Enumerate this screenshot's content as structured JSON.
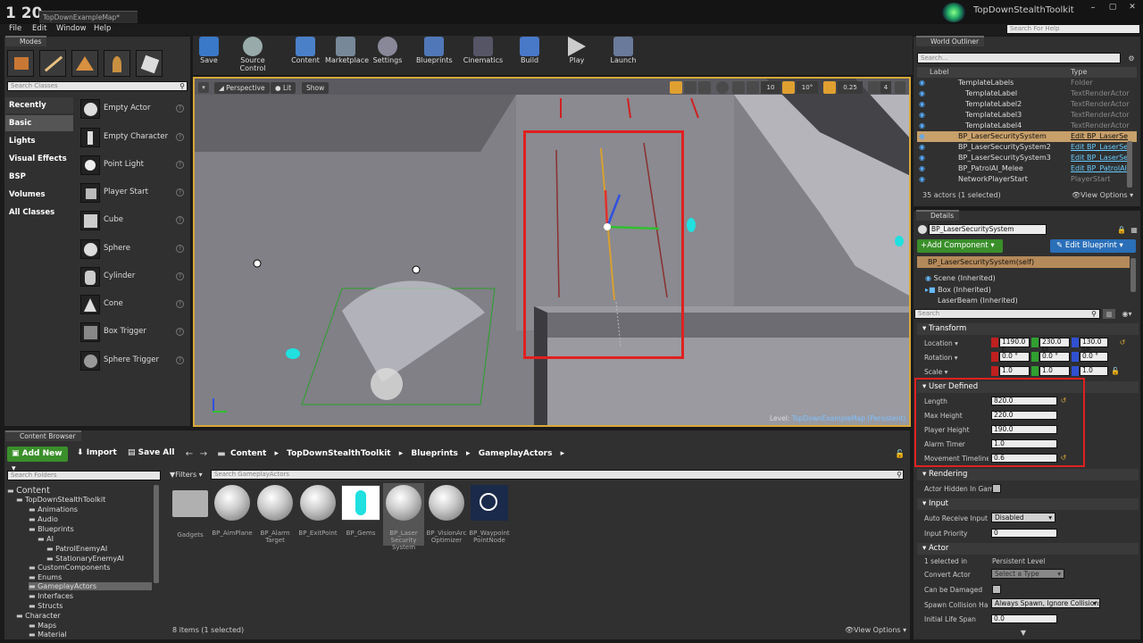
{
  "app": {
    "logo_text": "1 20",
    "tab_title": "TopDownExampleMap*",
    "project": "TopDownStealthToolkit",
    "help_search_placeholder": "Search For Help"
  },
  "menu": [
    "File",
    "Edit",
    "Window",
    "Help"
  ],
  "modes": {
    "tab": "Modes",
    "search_placeholder": "Search Classes",
    "categories": [
      "Recently Placed",
      "Basic",
      "Lights",
      "Visual Effects",
      "BSP",
      "Volumes",
      "All Classes"
    ],
    "items": [
      "Empty Actor",
      "Empty Character",
      "Point Light",
      "Player Start",
      "Cube",
      "Sphere",
      "Cylinder",
      "Cone",
      "Box Trigger",
      "Sphere Trigger"
    ]
  },
  "toolbar": [
    "Save",
    "Source Control",
    "Content",
    "Marketplace",
    "Settings",
    "Blueprints",
    "Cinematics",
    "Build",
    "Play",
    "Launch"
  ],
  "viewport": {
    "perspective": "Perspective",
    "lit": "Lit",
    "show": "Show",
    "grid": "10",
    "angle": "10°",
    "scale": "0.25",
    "cam": "4",
    "level_label": "Level:",
    "level_name": "TopDownExampleMap (Persistent)"
  },
  "outliner": {
    "tab": "World Outliner",
    "search_placeholder": "Search...",
    "col_label": "Label",
    "col_type": "Type",
    "rows": [
      {
        "label": "TemplateLabels",
        "type": "Folder"
      },
      {
        "label": "TemplateLabel",
        "type": "TextRenderActor"
      },
      {
        "label": "TemplateLabel2",
        "type": "TextRenderActor"
      },
      {
        "label": "TemplateLabel3",
        "type": "TextRenderActor"
      },
      {
        "label": "TemplateLabel4",
        "type": "TextRenderActor"
      },
      {
        "label": "BP_LaserSecuritySystem",
        "type": "Edit BP_LaserSe"
      },
      {
        "label": "BP_LaserSecuritySystem2",
        "type": "Edit BP_LaserSe"
      },
      {
        "label": "BP_LaserSecuritySystem3",
        "type": "Edit BP_LaserSe"
      },
      {
        "label": "BP_PatrolAI_Melee",
        "type": "Edit BP_PatrolAI"
      },
      {
        "label": "NetworkPlayerStart",
        "type": "PlayerStart"
      }
    ],
    "count": "35 actors (1 selected)",
    "view_options": "View Options"
  },
  "details": {
    "tab": "Details",
    "name": "BP_LaserSecuritySystem",
    "add_component": "+Add Component",
    "edit_blueprint": "Edit Blueprint",
    "self": "BP_LaserSecuritySystem(self)",
    "components": [
      "Scene (Inherited)",
      "Box (Inherited)",
      "LaserBeam (Inherited)"
    ],
    "search_placeholder": "Search",
    "transform": {
      "title": "Transform",
      "location_label": "Location",
      "rotation_label": "Rotation",
      "scale_label": "Scale",
      "location": [
        "1190.0 c",
        "230.0 cr",
        "130.0 cn"
      ],
      "rotation": [
        "0.0 °",
        "0.0 °",
        "0.0 °"
      ],
      "scale": [
        "1.0",
        "1.0",
        "1.0"
      ]
    },
    "user_defined": {
      "title": "User Defined",
      "props": [
        {
          "label": "Length",
          "value": "820.0"
        },
        {
          "label": "Max Height",
          "value": "220.0"
        },
        {
          "label": "Player Height",
          "value": "190.0"
        },
        {
          "label": "Alarm Timer",
          "value": "1.0"
        },
        {
          "label": "Movement Timeline S",
          "value": "0.6"
        }
      ]
    },
    "rendering": {
      "title": "Rendering",
      "hidden_label": "Actor Hidden In Game"
    },
    "input": {
      "title": "Input",
      "auto_label": "Auto Receive Input",
      "auto_value": "Disabled",
      "priority_label": "Input Priority",
      "priority_value": "0"
    },
    "actor": {
      "title": "Actor",
      "selected_in": "1 selected in",
      "persistent": "Persistent Level",
      "convert_label": "Convert Actor",
      "convert_value": "Select a Type",
      "damaged_label": "Can be Damaged",
      "spawn_label": "Spawn Collision Hand",
      "spawn_value": "Always Spawn, Ignore Collisions",
      "life_label": "Initial Life Span",
      "life_value": "0.0"
    }
  },
  "content_browser": {
    "tab": "Content Browser",
    "add_new": "Add New",
    "import": "Import",
    "save_all": "Save All",
    "breadcrumb": [
      "Content",
      "TopDownStealthToolkit",
      "Blueprints",
      "GameplayActors"
    ],
    "folder_search_placeholder": "Search Folders",
    "filters": "Filters",
    "asset_search_placeholder": "Search GameplayActors",
    "tree": [
      "Content",
      "TopDownStealthToolkit",
      "Animations",
      "Audio",
      "Blueprints",
      "AI",
      "PatrolEnemyAI",
      "StationaryEnemyAI",
      "CustomComponents",
      "Enums",
      "GameplayActors",
      "Interfaces",
      "Structs",
      "Character",
      "Maps",
      "Material"
    ],
    "assets": [
      "Gadgets",
      "BP_AimPlane",
      "BP_Alarm Target",
      "BP_ExitPoint",
      "BP_Gems",
      "BP_Laser Security System",
      "BP_VisionArc Optimizer",
      "BP_Waypoint PointNode"
    ],
    "count": "8 items (1 selected)",
    "view_options": "View Options"
  },
  "colors": {
    "accent": "#e0b040",
    "highlight_box": "#e02020",
    "add_green": "#3a8f2a",
    "edit_blue": "#2a6fb8"
  }
}
